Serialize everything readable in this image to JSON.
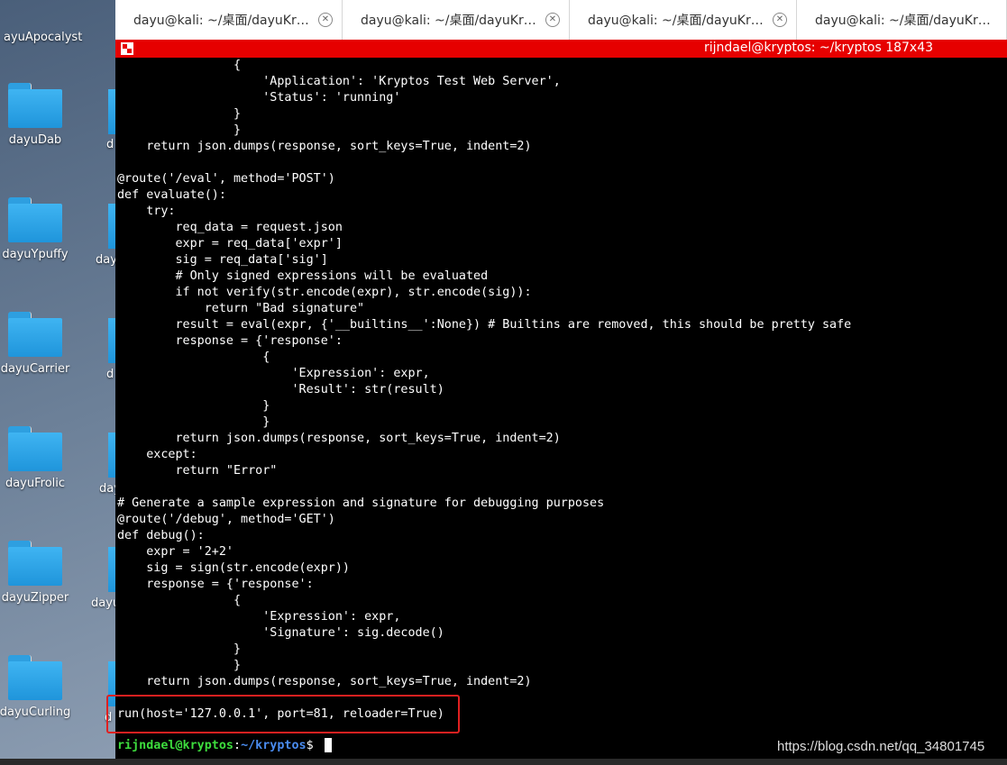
{
  "desktop": {
    "icons": [
      {
        "label": "ayuApocalyst"
      },
      {
        "label": "dayuDab"
      },
      {
        "label": "dayuYpuffy"
      },
      {
        "label": "dayuCarrier"
      },
      {
        "label": "dayuFrolic"
      },
      {
        "label": "dayuZipper"
      },
      {
        "label": "dayuCurling"
      }
    ],
    "partial_labels": [
      "d",
      "day",
      "d",
      "day",
      "dayu",
      "d"
    ]
  },
  "tabs": [
    {
      "label": "dayu@kali: ~/桌面/dayuKryptos"
    },
    {
      "label": "dayu@kali: ~/桌面/dayuKryptos/..."
    },
    {
      "label": "dayu@kali: ~/桌面/dayuKryptos"
    },
    {
      "label": "dayu@kali: ~/桌面/dayuKryptos/..."
    }
  ],
  "terminal": {
    "title": "rijndael@kryptos: ~/kryptos 187x43",
    "lines": [
      "                {",
      "                    'Application': 'Kryptos Test Web Server',",
      "                    'Status': 'running'",
      "                }",
      "                }",
      "    return json.dumps(response, sort_keys=True, indent=2)",
      "",
      "@route('/eval', method='POST')",
      "def evaluate():",
      "    try:",
      "        req_data = request.json",
      "        expr = req_data['expr']",
      "        sig = req_data['sig']",
      "        # Only signed expressions will be evaluated",
      "        if not verify(str.encode(expr), str.encode(sig)):",
      "            return \"Bad signature\"",
      "        result = eval(expr, {'__builtins__':None}) # Builtins are removed, this should be pretty safe",
      "        response = {'response':",
      "                    {",
      "                        'Expression': expr,",
      "                        'Result': str(result)",
      "                    }",
      "                    }",
      "        return json.dumps(response, sort_keys=True, indent=2)",
      "    except:",
      "        return \"Error\"",
      "",
      "# Generate a sample expression and signature for debugging purposes",
      "@route('/debug', method='GET')",
      "def debug():",
      "    expr = '2+2'",
      "    sig = sign(str.encode(expr))",
      "    response = {'response':",
      "                {",
      "                    'Expression': expr,",
      "                    'Signature': sig.decode()",
      "                }",
      "                }",
      "    return json.dumps(response, sort_keys=True, indent=2)",
      "",
      "run(host='127.0.0.1', port=81, reloader=True)"
    ],
    "prompt_user": "rijndael@kryptos",
    "prompt_sep": ":",
    "prompt_path": "~/kryptos",
    "prompt_symbol": "$"
  },
  "watermark": "https://blog.csdn.net/qq_34801745"
}
